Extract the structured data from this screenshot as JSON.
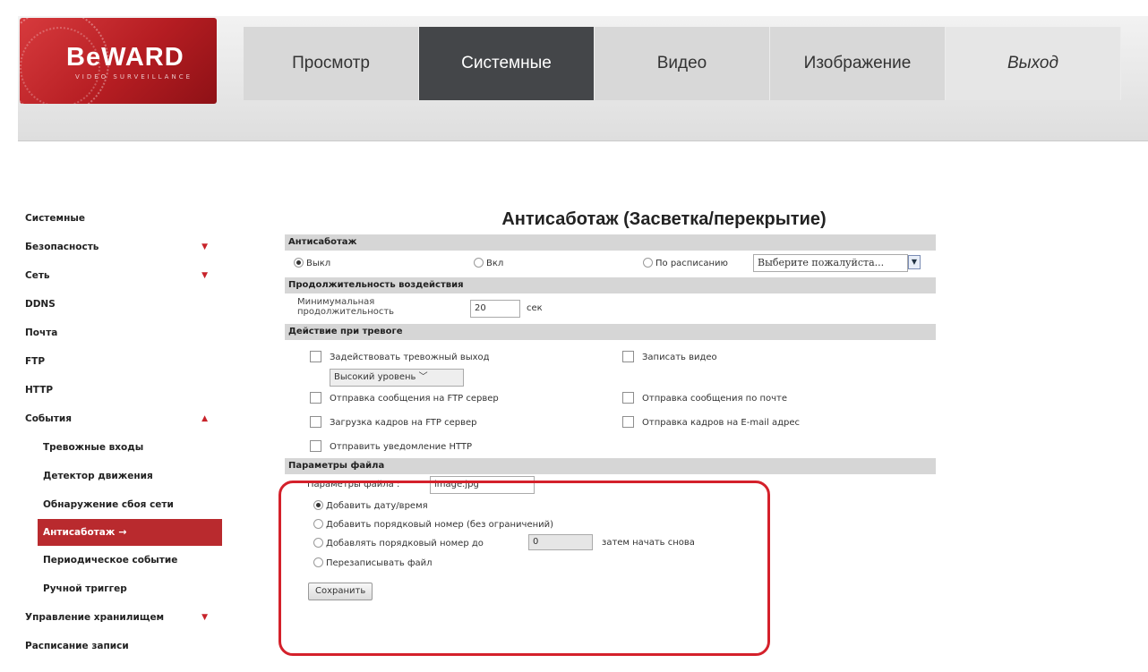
{
  "logo": {
    "text": "BeWARD",
    "subtitle": "VIDEO SURVEILLANCE"
  },
  "nav": [
    "Просмотр",
    "Системные",
    "Видео",
    "Изображение",
    "Выход"
  ],
  "sidebar": {
    "items": [
      {
        "label": "Системные",
        "arrow": ""
      },
      {
        "label": "Безопасность",
        "arrow": "▼"
      },
      {
        "label": "Сеть",
        "arrow": "▼"
      },
      {
        "label": "DDNS",
        "arrow": ""
      },
      {
        "label": "Почта",
        "arrow": ""
      },
      {
        "label": "FTP",
        "arrow": ""
      },
      {
        "label": "HTTP",
        "arrow": ""
      },
      {
        "label": "События",
        "arrow": "▲"
      },
      {
        "label": "Тревожные входы",
        "arrow": ""
      },
      {
        "label": "Детектор движения",
        "arrow": ""
      },
      {
        "label": "Обнаружение сбоя сети",
        "arrow": ""
      },
      {
        "label": "Антисаботаж",
        "arrow": "→"
      },
      {
        "label": "Периодическое событие",
        "arrow": ""
      },
      {
        "label": "Ручной триггер",
        "arrow": ""
      },
      {
        "label": "Управление хранилищем",
        "arrow": "▼"
      },
      {
        "label": "Расписание записи",
        "arrow": ""
      }
    ]
  },
  "main": {
    "title": "Антисаботаж (Засветка/перекрытие)",
    "antisabotage": {
      "header": "Антисаботаж",
      "off": "Выкл",
      "on": "Вкл",
      "schedule": "По расписанию",
      "schedule_select": "Выберите пожалуйста..."
    },
    "duration": {
      "header": "Продолжительность воздействия",
      "label_line1": "Минимумальная",
      "label_line2": "продолжительность",
      "value": "20",
      "unit": "сек"
    },
    "actions": {
      "header": "Действие при тревоге",
      "alarm_output": "Задействовать тревожный выход",
      "level_select": "Высокий уровень",
      "record_video": "Записать видео",
      "ftp_message": "Отправка сообщения на FTP сервер",
      "mail_message": "Отправка сообщения по почте",
      "ftp_frames": "Загрузка кадров на FTP сервер",
      "email_frames": "Отправка кадров на E-mail адрес",
      "http_notify": "Отправить уведомление HTTP"
    },
    "file": {
      "header": "Параметры файла",
      "name_label": "Параметры файла :",
      "name_value": "image.jpg",
      "opt_datetime": "Добавить дату/время",
      "opt_seq_unlimited": "Добавить порядковый номер (без ограничений)",
      "opt_seq_to": "Добавлять порядковый номер до",
      "seq_value": "0",
      "opt_seq_then": "затем начать снова",
      "opt_overwrite": "Перезаписывать файл",
      "save": "Сохранить"
    }
  }
}
